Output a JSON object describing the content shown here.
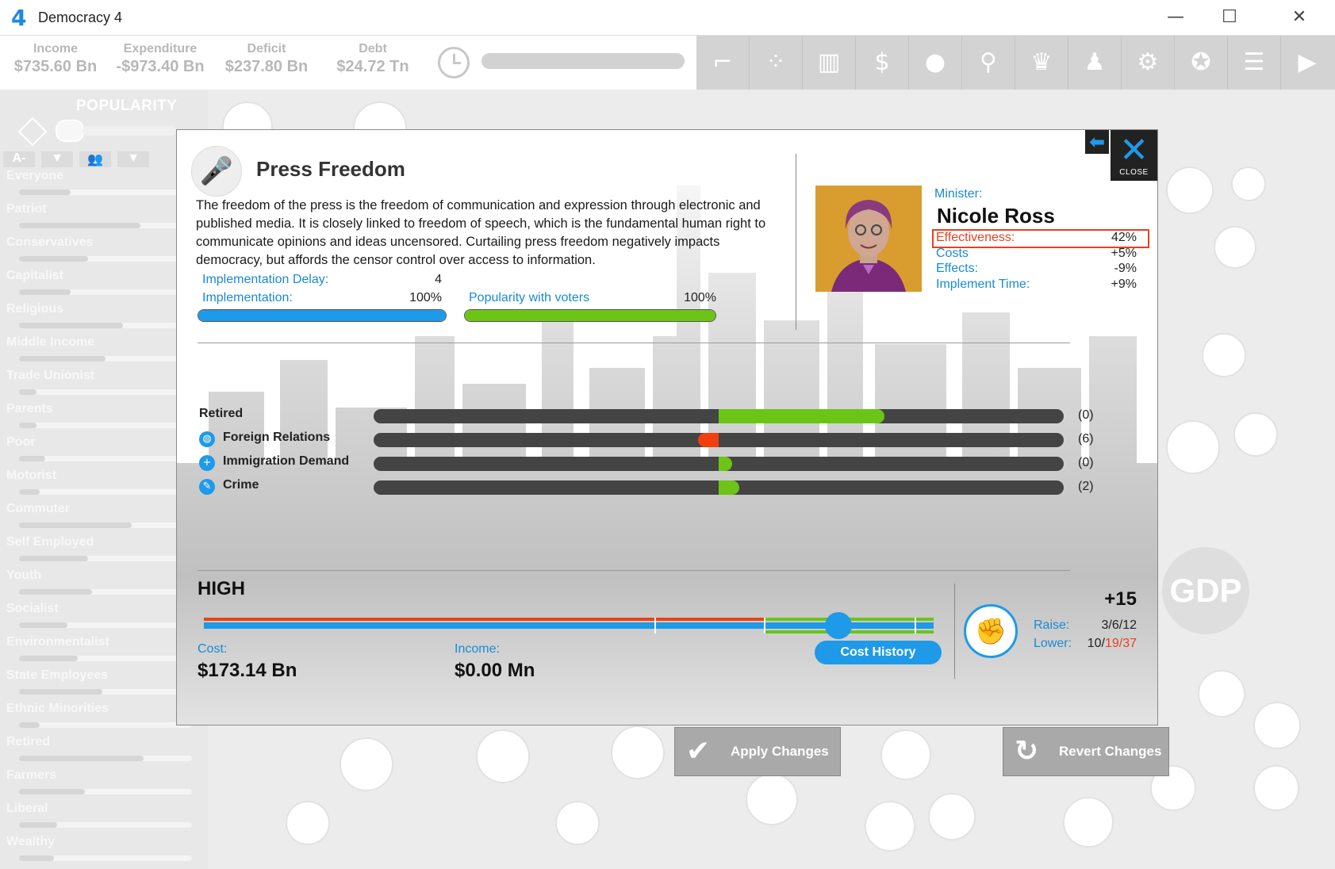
{
  "window": {
    "title": "Democracy 4",
    "logo": "4",
    "minimize": "—",
    "maximize": "☐",
    "close": "✕"
  },
  "topbar": {
    "stats": [
      {
        "label": "Income",
        "value": "$735.60 Bn"
      },
      {
        "label": "Expenditure",
        "value": "-$973.40 Bn"
      },
      {
        "label": "Deficit",
        "value": "$237.80 Bn"
      },
      {
        "label": "Debt",
        "value": "$24.72 Tn"
      }
    ],
    "icons": [
      "gun-icon",
      "scatter-icon",
      "bar-chart-icon",
      "dollar-icon",
      "lightbulb-icon",
      "search-icon",
      "trophy-icon",
      "group-icon",
      "gear-icon",
      "medal-icon",
      "document-icon",
      "play-icon"
    ]
  },
  "sidebar": {
    "heading": "POPULARITY",
    "tools": [
      "A-",
      "▼",
      "👥",
      "▼"
    ],
    "groups": [
      {
        "name": "Everyone",
        "fill": 0.3
      },
      {
        "name": "Patriot",
        "fill": 0.7
      },
      {
        "name": "Conservatives",
        "fill": 0.4
      },
      {
        "name": "Capitalist",
        "fill": 0.3
      },
      {
        "name": "Religious",
        "fill": 0.6
      },
      {
        "name": "Middle Income",
        "fill": 0.5
      },
      {
        "name": "Trade Unionist",
        "fill": 0.1
      },
      {
        "name": "Parents",
        "fill": 0.1
      },
      {
        "name": "Poor",
        "fill": 0.15
      },
      {
        "name": "Motorist",
        "fill": 0.12
      },
      {
        "name": "Commuter",
        "fill": 0.65
      },
      {
        "name": "Self Employed",
        "fill": 0.4
      },
      {
        "name": "Youth",
        "fill": 0.42
      },
      {
        "name": "Socialist",
        "fill": 0.28
      },
      {
        "name": "Environmentalist",
        "fill": 0.34
      },
      {
        "name": "State Employees",
        "fill": 0.48
      },
      {
        "name": "Ethnic Minorities",
        "fill": 0.12
      },
      {
        "name": "Retired",
        "fill": 0.72
      },
      {
        "name": "Farmers",
        "fill": 0.38
      },
      {
        "name": "Liberal",
        "fill": 0.22
      },
      {
        "name": "Wealthy",
        "fill": 0.2
      }
    ]
  },
  "policy": {
    "title": "Press Freedom",
    "description": "The freedom of the press is the freedom of communication and expression through electronic and published media. It is closely linked to freedom of speech, which is the fundamental human right to communicate opinions and ideas uncensored. Curtailing press freedom negatively impacts democracy, but affords the censor control over access to information.",
    "implementation_delay_label": "Implementation Delay:",
    "implementation_delay": "4",
    "implementation_label": "Implementation:",
    "implementation": "100%",
    "implementation_fill": 1.0,
    "popularity_label": "Popularity with voters",
    "popularity": "100%",
    "popularity_fill": 1.0
  },
  "minister": {
    "label": "Minister:",
    "name": "Nicole Ross",
    "stats": [
      {
        "label": "Effectiveness:",
        "value": "42%",
        "highlight": true
      },
      {
        "label": "Costs",
        "value": "+5%"
      },
      {
        "label": "Effects:",
        "value": "-9%"
      },
      {
        "label": "Implement Time:",
        "value": "+9%"
      }
    ]
  },
  "dialog_buttons": {
    "back": "⬅",
    "close": "CLOSE"
  },
  "effects": [
    {
      "name": "Retired",
      "value": "(0)",
      "magnitude": 0.24,
      "color": "#6cc417",
      "icon": ""
    },
    {
      "name": "Foreign Relations",
      "value": "(6)",
      "magnitude": -0.03,
      "color": "#f04010",
      "icon": "globe-icon"
    },
    {
      "name": "Immigration Demand",
      "value": "(0)",
      "magnitude": 0.02,
      "color": "#6cc417",
      "icon": "plus-icon"
    },
    {
      "name": "Crime",
      "value": "(2)",
      "magnitude": 0.03,
      "color": "#6cc417",
      "icon": "crime-icon"
    }
  ],
  "slider": {
    "level": "HIGH",
    "position": 0.87,
    "segments": 4
  },
  "cost": {
    "label": "Cost:",
    "value": "$173.14 Bn"
  },
  "income": {
    "label": "Income:",
    "value": "$0.00 Mn"
  },
  "cost_history": "Cost History",
  "support": {
    "change": "+15",
    "raise_label": "Raise:",
    "raise": "3/6/12",
    "lower_label": "Lower:",
    "lower_a": "10/",
    "lower_b": "19/37"
  },
  "buttons": {
    "apply": "Apply Changes",
    "revert": "Revert Changes"
  },
  "colors": {
    "accent": "#1e9ae8",
    "positive": "#6cc417",
    "negative": "#f04010",
    "minister_bg": "#d99c2e"
  }
}
